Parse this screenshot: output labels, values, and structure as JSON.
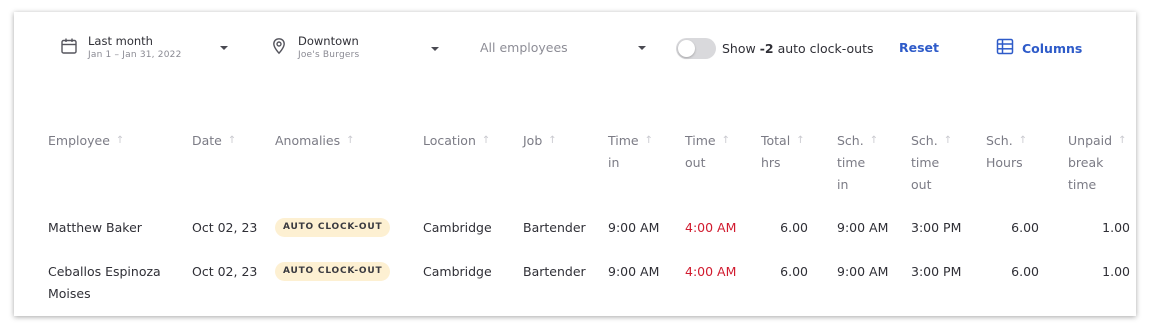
{
  "filters": {
    "date": {
      "title": "Last month",
      "subtitle": "Jan 1 – Jan 31, 2022",
      "icon": "calendar-icon"
    },
    "location": {
      "title": "Downtown",
      "subtitle": "Joe's Burgers",
      "icon": "location-pin-icon"
    },
    "employees": {
      "value": "All employees"
    }
  },
  "toggle": {
    "prefix": "Show ",
    "count": "-2",
    "suffix": " auto clock-outs",
    "on": false
  },
  "actions": {
    "reset": "Reset",
    "columns": "Columns"
  },
  "colors": {
    "accent": "#2e5bc9",
    "error": "#d11b2f",
    "badge_bg": "#fdf0d2"
  },
  "table": {
    "columns": [
      {
        "label": "Employee"
      },
      {
        "label": "Date"
      },
      {
        "label": "Anomalies"
      },
      {
        "label": "Location"
      },
      {
        "label": "Job"
      },
      {
        "label_lines": [
          "Time",
          "in"
        ]
      },
      {
        "label_lines": [
          "Time",
          "out"
        ]
      },
      {
        "label_lines": [
          "Total",
          "hrs"
        ]
      },
      {
        "label_lines": [
          "Sch.",
          "time",
          "in"
        ]
      },
      {
        "label_lines": [
          "Sch.",
          "time",
          "out"
        ]
      },
      {
        "label_lines": [
          "Sch.",
          "Hours"
        ]
      },
      {
        "label_lines": [
          "Unpaid",
          "break",
          "time"
        ]
      }
    ],
    "rows": [
      {
        "employee_lines": [
          "Matthew Baker"
        ],
        "date": "Oct 02, 23",
        "anomaly": "AUTO CLOCK-OUT",
        "location": "Cambridge",
        "job": "Bartender",
        "time_in": "9:00 AM",
        "time_out": "4:00 AM",
        "total_hrs": "6.00",
        "sch_time_in": "9:00 AM",
        "sch_time_out": "3:00 PM",
        "sch_hours": "6.00",
        "unpaid_break": "1.00"
      },
      {
        "employee_lines": [
          "Ceballos Espinoza",
          "Moises"
        ],
        "date": "Oct 02, 23",
        "anomaly": "AUTO CLOCK-OUT",
        "location": "Cambridge",
        "job": "Bartender",
        "time_in": "9:00 AM",
        "time_out": "4:00 AM",
        "total_hrs": "6.00",
        "sch_time_in": "9:00 AM",
        "sch_time_out": "3:00 PM",
        "sch_hours": "6.00",
        "unpaid_break": "1.00"
      }
    ]
  }
}
